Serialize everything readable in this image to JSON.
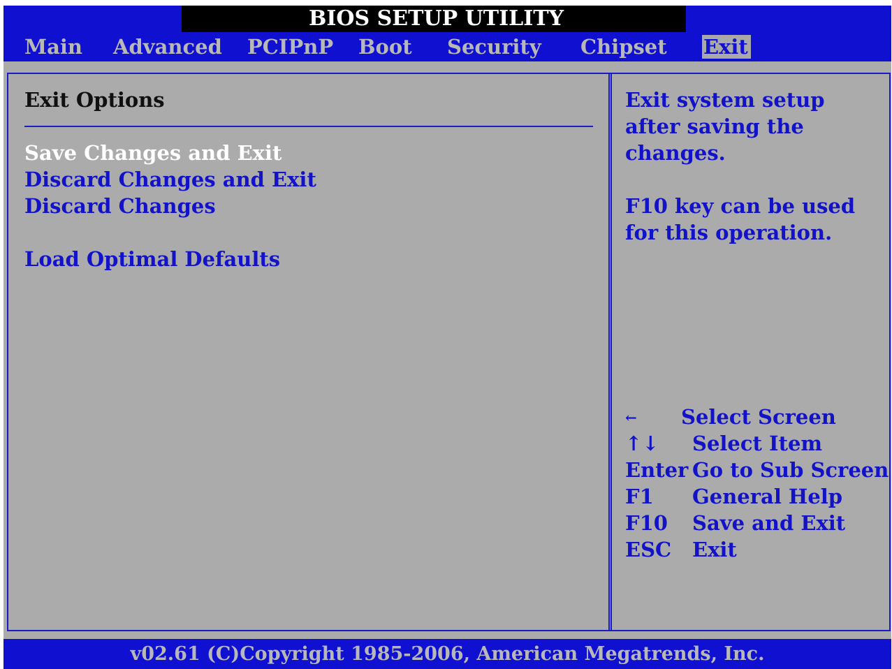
{
  "title": "BIOS SETUP UTILITY",
  "menu": [
    {
      "label": "Main"
    },
    {
      "label": "Advanced"
    },
    {
      "label": "PCIPnP"
    },
    {
      "label": "Boot"
    },
    {
      "label": "Security"
    },
    {
      "label": "Chipset"
    },
    {
      "label": "Exit",
      "active": true
    }
  ],
  "section_title": "Exit Options",
  "options": [
    {
      "label": "Save Changes and Exit",
      "selected": true
    },
    {
      "label": "Discard Changes and Exit"
    },
    {
      "label": "Discard Changes"
    },
    {
      "label": "Load Optimal Defaults"
    }
  ],
  "help": {
    "lines": [
      "Exit system setup",
      "after saving the",
      "changes.",
      "F10 key can be used",
      "for this operation."
    ]
  },
  "keys": [
    {
      "key": "←",
      "desc": "Select Screen"
    },
    {
      "key": "↑↓",
      "desc": "Select Item"
    },
    {
      "key": "Enter",
      "desc": "Go to Sub Screen"
    },
    {
      "key": "F1",
      "desc": "General Help"
    },
    {
      "key": "F10",
      "desc": "Save and Exit"
    },
    {
      "key": "ESC",
      "desc": "Exit"
    }
  ],
  "footer": "v02.61 (C)Copyright 1985-2006, American Megatrends, Inc.",
  "colors": {
    "bar_blue": "#1010d0",
    "panel_gray": "#ababab",
    "text_blue": "#1212c8",
    "selected_white": "#ffffff"
  }
}
